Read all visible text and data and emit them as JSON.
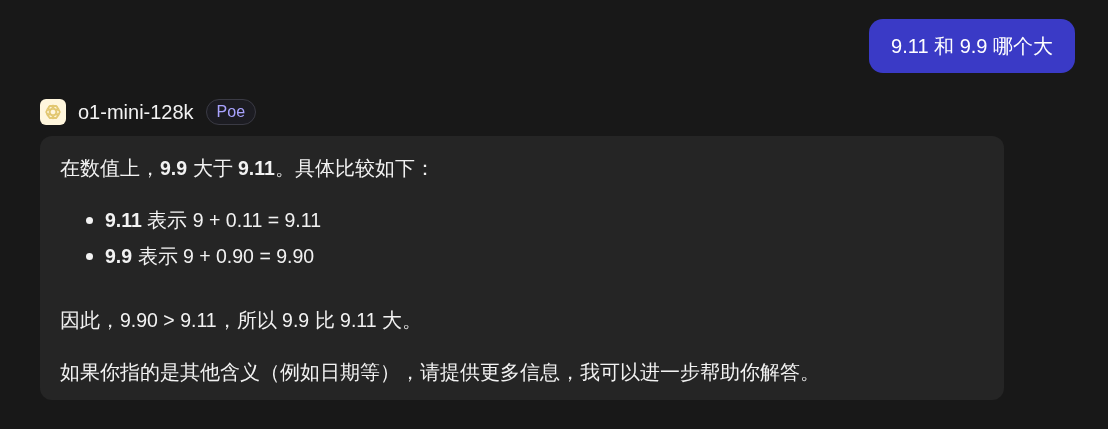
{
  "user_message": {
    "text": "9.11 和 9.9 哪个大"
  },
  "bot": {
    "name": "o1-mini-128k",
    "badge": "Poe"
  },
  "response": {
    "blocks": [
      {
        "kind": "paragraph",
        "text": "在数值上，**9.9** 大于 **9.11**。具体比较如下："
      },
      {
        "kind": "list",
        "items": [
          "**9.11** 表示 9 + 0.11 = 9.11",
          "**9.9** 表示 9 + 0.90 = 9.90"
        ]
      },
      {
        "kind": "paragraph",
        "text": "因此，9.90 > 9.11，所以 9.9 比 9.11 大。"
      },
      {
        "kind": "paragraph",
        "text": "如果你指的是其他含义（例如日期等），请提供更多信息，我可以进一步帮助你解答。"
      }
    ]
  }
}
